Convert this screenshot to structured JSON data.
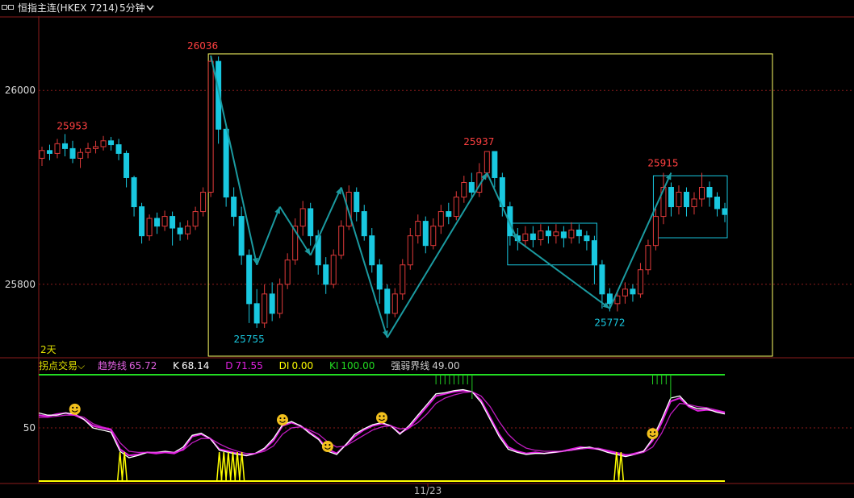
{
  "header": {
    "title": "恒指主连(HKEX 7214)",
    "period": "5分钟"
  },
  "colors": {
    "up": "#e03a3a",
    "down": "#19c8e0",
    "box_main": "#ffff66",
    "box_range": "#19c8e0",
    "zigzag": "#1b9aa0",
    "ma_white": "#ffffff",
    "ma_magenta": "#e020e0",
    "signal_yellow": "#ffff00",
    "bar_green": "#22cc22"
  },
  "indicator_header": {
    "name": "拐点交易",
    "trend_label": "趋势线",
    "trend_value": "65.72",
    "k_label": "K",
    "k_value": "68.14",
    "d_label": "D",
    "d_value": "71.55",
    "di_label": "DI",
    "di_value": "0.00",
    "ki_label": "KI",
    "ki_value": "100.00",
    "strength_label": "强弱界线",
    "strength_value": "49.00"
  },
  "chart_data": {
    "type": "candlestick",
    "price_axis": {
      "ticks": [
        26000,
        25800
      ],
      "range": [
        25725,
        26075
      ]
    },
    "indicator_axis": {
      "ticks": [
        50
      ]
    },
    "x_label": "11/23",
    "range_label": "2天",
    "annotations": {
      "highs": [
        {
          "label": "25953",
          "price": 25953
        },
        {
          "label": "26036",
          "price": 26036
        },
        {
          "label": "25937",
          "price": 25937
        },
        {
          "label": "25915",
          "price": 25915
        }
      ],
      "lows": [
        {
          "label": "25755",
          "price": 25755
        },
        {
          "label": "25772",
          "price": 25772
        }
      ]
    },
    "zigzag_prices": [
      26036,
      25820,
      25880,
      25830,
      25900,
      25745,
      25915,
      25845,
      25775,
      25915
    ],
    "candles": [
      [
        25930,
        25938,
        25922,
        25942
      ],
      [
        25938,
        25935,
        25928,
        25944
      ],
      [
        25935,
        25945,
        25930,
        25950
      ],
      [
        25945,
        25940,
        25932,
        25955
      ],
      [
        25940,
        25930,
        25925,
        25948
      ],
      [
        25930,
        25936,
        25920,
        25940
      ],
      [
        25936,
        25940,
        25930,
        25946
      ],
      [
        25940,
        25942,
        25935,
        25948
      ],
      [
        25942,
        25948,
        25938,
        25953
      ],
      [
        25948,
        25944,
        25938,
        25952
      ],
      [
        25944,
        25935,
        25928,
        25950
      ],
      [
        25935,
        25910,
        25900,
        25938
      ],
      [
        25910,
        25880,
        25870,
        25912
      ],
      [
        25880,
        25850,
        25842,
        25884
      ],
      [
        25850,
        25868,
        25845,
        25872
      ],
      [
        25868,
        25860,
        25852,
        25874
      ],
      [
        25860,
        25870,
        25855,
        25876
      ],
      [
        25870,
        25858,
        25840,
        25875
      ],
      [
        25858,
        25852,
        25845,
        25864
      ],
      [
        25852,
        25860,
        25846,
        25866
      ],
      [
        25860,
        25875,
        25856,
        25880
      ],
      [
        25875,
        25895,
        25870,
        25900
      ],
      [
        25895,
        26030,
        25890,
        26036
      ],
      [
        26030,
        25960,
        25945,
        26035
      ],
      [
        25960,
        25890,
        25880,
        25965
      ],
      [
        25890,
        25870,
        25860,
        25900
      ],
      [
        25870,
        25830,
        25820,
        25880
      ],
      [
        25830,
        25780,
        25760,
        25836
      ],
      [
        25780,
        25760,
        25755,
        25795
      ],
      [
        25760,
        25790,
        25755,
        25800
      ],
      [
        25790,
        25770,
        25762,
        25802
      ],
      [
        25770,
        25800,
        25765,
        25806
      ],
      [
        25800,
        25825,
        25795,
        25832
      ],
      [
        25825,
        25860,
        25820,
        25868
      ],
      [
        25860,
        25878,
        25850,
        25886
      ],
      [
        25878,
        25850,
        25840,
        25884
      ],
      [
        25850,
        25820,
        25810,
        25856
      ],
      [
        25820,
        25800,
        25790,
        25828
      ],
      [
        25800,
        25830,
        25796,
        25836
      ],
      [
        25830,
        25860,
        25826,
        25866
      ],
      [
        25860,
        25895,
        25856,
        25902
      ],
      [
        25895,
        25875,
        25865,
        25900
      ],
      [
        25875,
        25850,
        25845,
        25882
      ],
      [
        25850,
        25820,
        25812,
        25858
      ],
      [
        25820,
        25795,
        25780,
        25826
      ],
      [
        25795,
        25770,
        25755,
        25800
      ],
      [
        25770,
        25790,
        25766,
        25796
      ],
      [
        25790,
        25820,
        25784,
        25826
      ],
      [
        25820,
        25850,
        25815,
        25858
      ],
      [
        25850,
        25865,
        25842,
        25872
      ],
      [
        25865,
        25840,
        25832,
        25870
      ],
      [
        25840,
        25860,
        25836,
        25868
      ],
      [
        25860,
        25875,
        25852,
        25882
      ],
      [
        25875,
        25870,
        25862,
        25884
      ],
      [
        25870,
        25890,
        25866,
        25896
      ],
      [
        25890,
        25905,
        25884,
        25912
      ],
      [
        25905,
        25895,
        25888,
        25915
      ],
      [
        25895,
        25915,
        25890,
        25925
      ],
      [
        25915,
        25937,
        25910,
        25937
      ],
      [
        25937,
        25910,
        25900,
        25937
      ],
      [
        25910,
        25880,
        25870,
        25915
      ],
      [
        25880,
        25850,
        25840,
        25885
      ],
      [
        25850,
        25845,
        25835,
        25858
      ],
      [
        25845,
        25852,
        25838,
        25860
      ],
      [
        25852,
        25846,
        25838,
        25860
      ],
      [
        25846,
        25855,
        25840,
        25862
      ],
      [
        25855,
        25850,
        25842,
        25860
      ],
      [
        25850,
        25854,
        25842,
        25862
      ],
      [
        25854,
        25848,
        25838,
        25860
      ],
      [
        25848,
        25856,
        25842,
        25864
      ],
      [
        25856,
        25850,
        25842,
        25862
      ],
      [
        25850,
        25845,
        25835,
        25855
      ],
      [
        25845,
        25820,
        25800,
        25850
      ],
      [
        25820,
        25790,
        25775,
        25825
      ],
      [
        25790,
        25780,
        25772,
        25796
      ],
      [
        25780,
        25788,
        25772,
        25794
      ],
      [
        25788,
        25795,
        25780,
        25802
      ],
      [
        25795,
        25790,
        25782,
        25800
      ],
      [
        25790,
        25815,
        25786,
        25822
      ],
      [
        25815,
        25840,
        25810,
        25846
      ],
      [
        25840,
        25870,
        25835,
        25878
      ],
      [
        25870,
        25900,
        25862,
        25915
      ],
      [
        25900,
        25880,
        25870,
        25905
      ],
      [
        25880,
        25895,
        25872,
        25902
      ],
      [
        25895,
        25880,
        25870,
        25900
      ],
      [
        25880,
        25888,
        25872,
        25895
      ],
      [
        25888,
        25900,
        25880,
        25915
      ],
      [
        25900,
        25890,
        25880,
        25906
      ],
      [
        25890,
        25878,
        25870,
        25895
      ],
      [
        25878,
        25872,
        25864,
        25884
      ]
    ],
    "series": [
      {
        "name": "趋势线",
        "values": [
          62,
          61,
          63,
          64,
          62,
          58,
          52,
          50,
          48,
          30,
          24,
          25,
          27,
          26,
          27,
          26,
          30,
          42,
          44,
          40,
          30,
          28,
          26,
          24,
          26,
          30,
          38,
          52,
          55,
          52,
          46,
          40,
          30,
          26,
          34,
          42,
          48,
          52,
          54,
          52,
          45,
          50,
          60,
          70,
          80,
          82,
          84,
          85,
          84,
          76,
          60,
          44,
          32,
          28,
          26,
          27,
          26,
          27,
          28,
          30,
          32,
          31,
          30,
          28,
          26,
          24,
          26,
          28,
          38,
          55,
          75,
          78,
          70,
          66,
          67,
          66,
          64
        ]
      },
      {
        "name": "K",
        "values": [
          64,
          62,
          62,
          64,
          63,
          58,
          50,
          48,
          46,
          28,
          22,
          24,
          27,
          27,
          28,
          27,
          32,
          43,
          45,
          40,
          29,
          27,
          25,
          24,
          26,
          31,
          40,
          53,
          56,
          52,
          45,
          39,
          28,
          25,
          34,
          44,
          49,
          53,
          55,
          52,
          44,
          52,
          62,
          72,
          82,
          83,
          85,
          86,
          84,
          74,
          58,
          42,
          30,
          27,
          25,
          26,
          26,
          27,
          28,
          29,
          31,
          32,
          30,
          27,
          25,
          23,
          25,
          28,
          40,
          58,
          78,
          80,
          71,
          68,
          68,
          65,
          63
        ]
      },
      {
        "name": "D",
        "values": [
          60,
          60,
          61,
          62,
          62,
          60,
          54,
          51,
          49,
          36,
          28,
          27,
          27,
          27,
          27,
          27,
          29,
          36,
          40,
          40,
          35,
          31,
          28,
          26,
          26,
          28,
          33,
          44,
          50,
          51,
          48,
          44,
          37,
          32,
          33,
          38,
          43,
          48,
          51,
          52,
          49,
          50,
          55,
          63,
          73,
          78,
          81,
          83,
          84,
          80,
          70,
          56,
          44,
          36,
          31,
          29,
          28,
          28,
          28,
          29,
          30,
          31,
          31,
          29,
          27,
          25,
          25,
          27,
          32,
          45,
          63,
          73,
          72,
          70,
          69,
          67,
          65
        ]
      }
    ],
    "smileys": [
      {
        "series_index": 4
      },
      {
        "series_index": 27
      },
      {
        "series_index": 32
      },
      {
        "series_index": 38
      },
      {
        "series_index": 68
      }
    ]
  }
}
